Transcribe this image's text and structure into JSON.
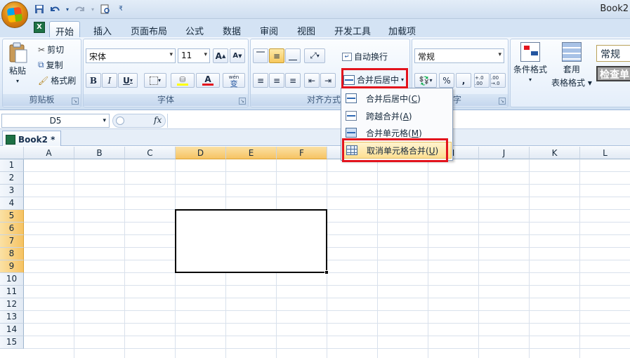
{
  "window": {
    "title": "Book2"
  },
  "quick_access": {
    "save": "save-icon",
    "undo": "undo-icon",
    "redo": "redo-icon",
    "preview": "preview-icon"
  },
  "tabs": [
    "开始",
    "插入",
    "页面布局",
    "公式",
    "数据",
    "审阅",
    "视图",
    "开发工具",
    "加载项"
  ],
  "ribbon": {
    "clipboard": {
      "label": "剪贴板",
      "paste": "粘贴",
      "cut": "剪切",
      "copy": "复制",
      "format_painter": "格式刷"
    },
    "font": {
      "label": "字体",
      "font_name": "宋体",
      "font_size": "11",
      "bold": "B",
      "italic": "I",
      "underline": "U",
      "grow": "A",
      "shrink": "A",
      "wen": "wén",
      "wen_char": "变"
    },
    "alignment": {
      "label": "对齐方式",
      "wrap": "自动换行",
      "merge_center": "合并后居中"
    },
    "number": {
      "label": "数字",
      "format": "常规",
      "percent": "%",
      "comma": ",",
      "inc_decimal": "+.0 .00",
      "dec_decimal": ".00 →.0"
    },
    "styles": {
      "conditional": "条件格式",
      "table_format_1": "套用",
      "table_format_2": "表格格式",
      "style_normal": "常规",
      "style_check": "检查单"
    }
  },
  "formula_bar": {
    "name_box": "D5",
    "fx": "fx"
  },
  "workbook_tab": {
    "name": "Book2 *"
  },
  "columns": [
    "A",
    "B",
    "C",
    "D",
    "E",
    "F",
    "G",
    "H",
    "I",
    "J",
    "K",
    "L"
  ],
  "rows": [
    "1",
    "2",
    "3",
    "4",
    "5",
    "6",
    "7",
    "8",
    "9",
    "10",
    "11",
    "12",
    "13",
    "14",
    "15"
  ],
  "merge_menu": {
    "items": [
      {
        "label": "合并后居中",
        "key": "C"
      },
      {
        "label": "跨越合并",
        "key": "A"
      },
      {
        "label": "合并单元格",
        "key": "M"
      },
      {
        "label": "取消单元格合并",
        "key": "U"
      }
    ]
  },
  "colors": {
    "highlight": "#e3141d",
    "selected_header": "#f6c363",
    "ribbon": "#dfeaf7"
  }
}
